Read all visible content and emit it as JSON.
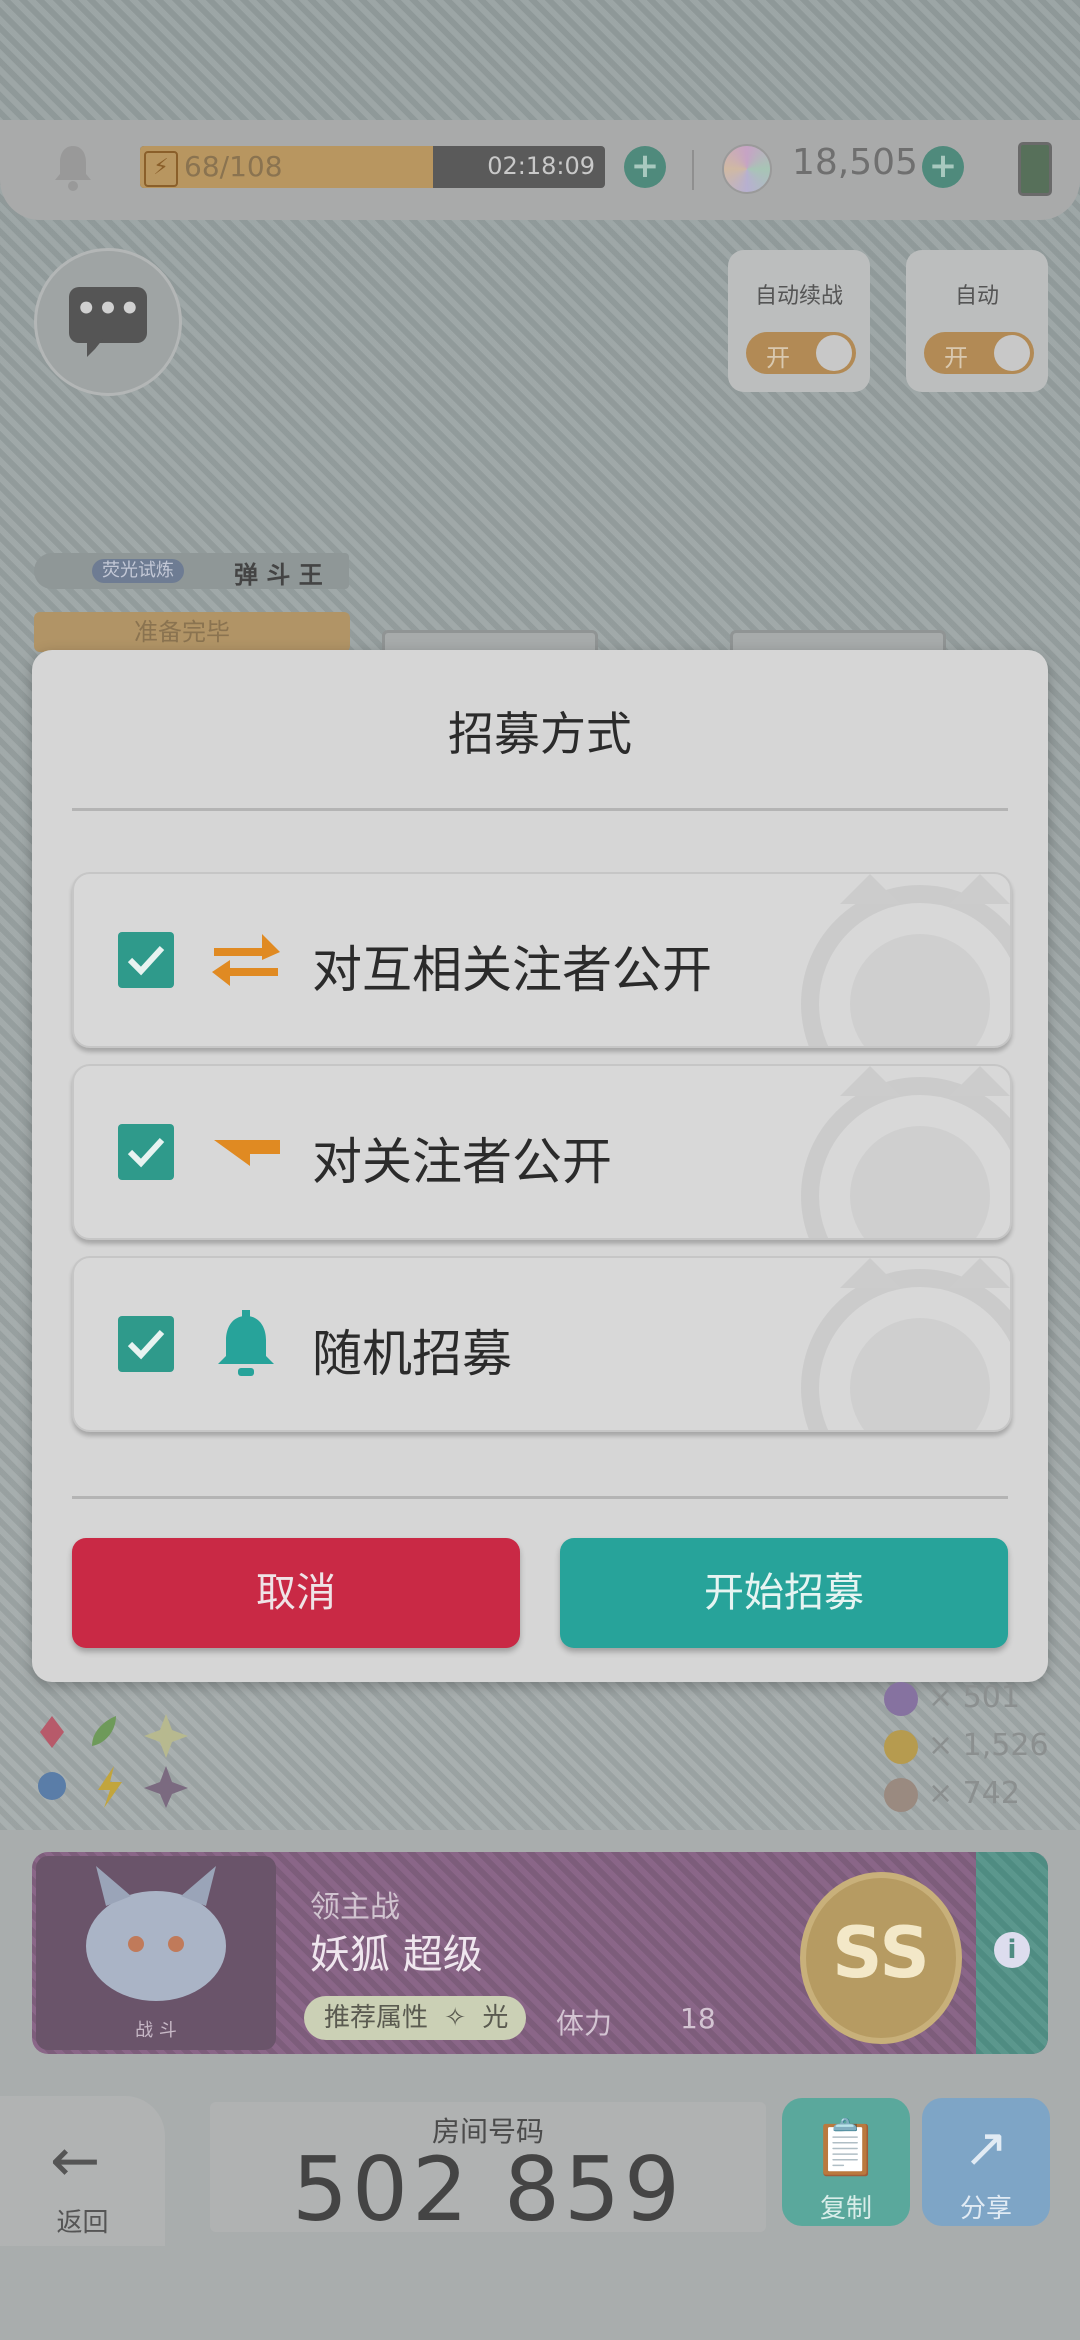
{
  "status_bar": {
    "stamina_text": "68/108",
    "stamina_fraction": 0.63,
    "timer": "02:18:09",
    "gem_count": "18,505"
  },
  "auto_continue": {
    "label": "自动续战",
    "toggle_text": "开"
  },
  "auto": {
    "label": "自动",
    "toggle_text": "开"
  },
  "player": {
    "tag": "荧光试炼",
    "name": "弹 斗 王",
    "ready": "准备完毕"
  },
  "modal": {
    "title": "招募方式",
    "options": [
      {
        "label": "对互相关注者公开",
        "checked": true,
        "icon": "mutual-arrows-icon"
      },
      {
        "label": "对关注者公开",
        "checked": true,
        "icon": "follow-flag-icon"
      },
      {
        "label": "随机招募",
        "checked": true,
        "icon": "bell-icon"
      }
    ],
    "cancel_label": "取消",
    "start_label": "开始招募"
  },
  "rewards": [
    "× 501",
    "× 1,526",
    "× 742"
  ],
  "boss": {
    "portrait_label": "战 斗",
    "mode": "领主战",
    "name": "妖狐 超级",
    "recommend_label": "推荐属性",
    "recommend_attr": "光",
    "stamina_label": "体力",
    "stamina_value": "18",
    "rank": "SS"
  },
  "bottom": {
    "back_label": "返回",
    "room_label": "房间号码",
    "room_number": "502 859",
    "copy_label": "复制",
    "share_label": "分享"
  },
  "colors": {
    "accent_teal": "#27a39a",
    "cancel_red": "#c92945",
    "orange_icon": "#e08a22"
  }
}
